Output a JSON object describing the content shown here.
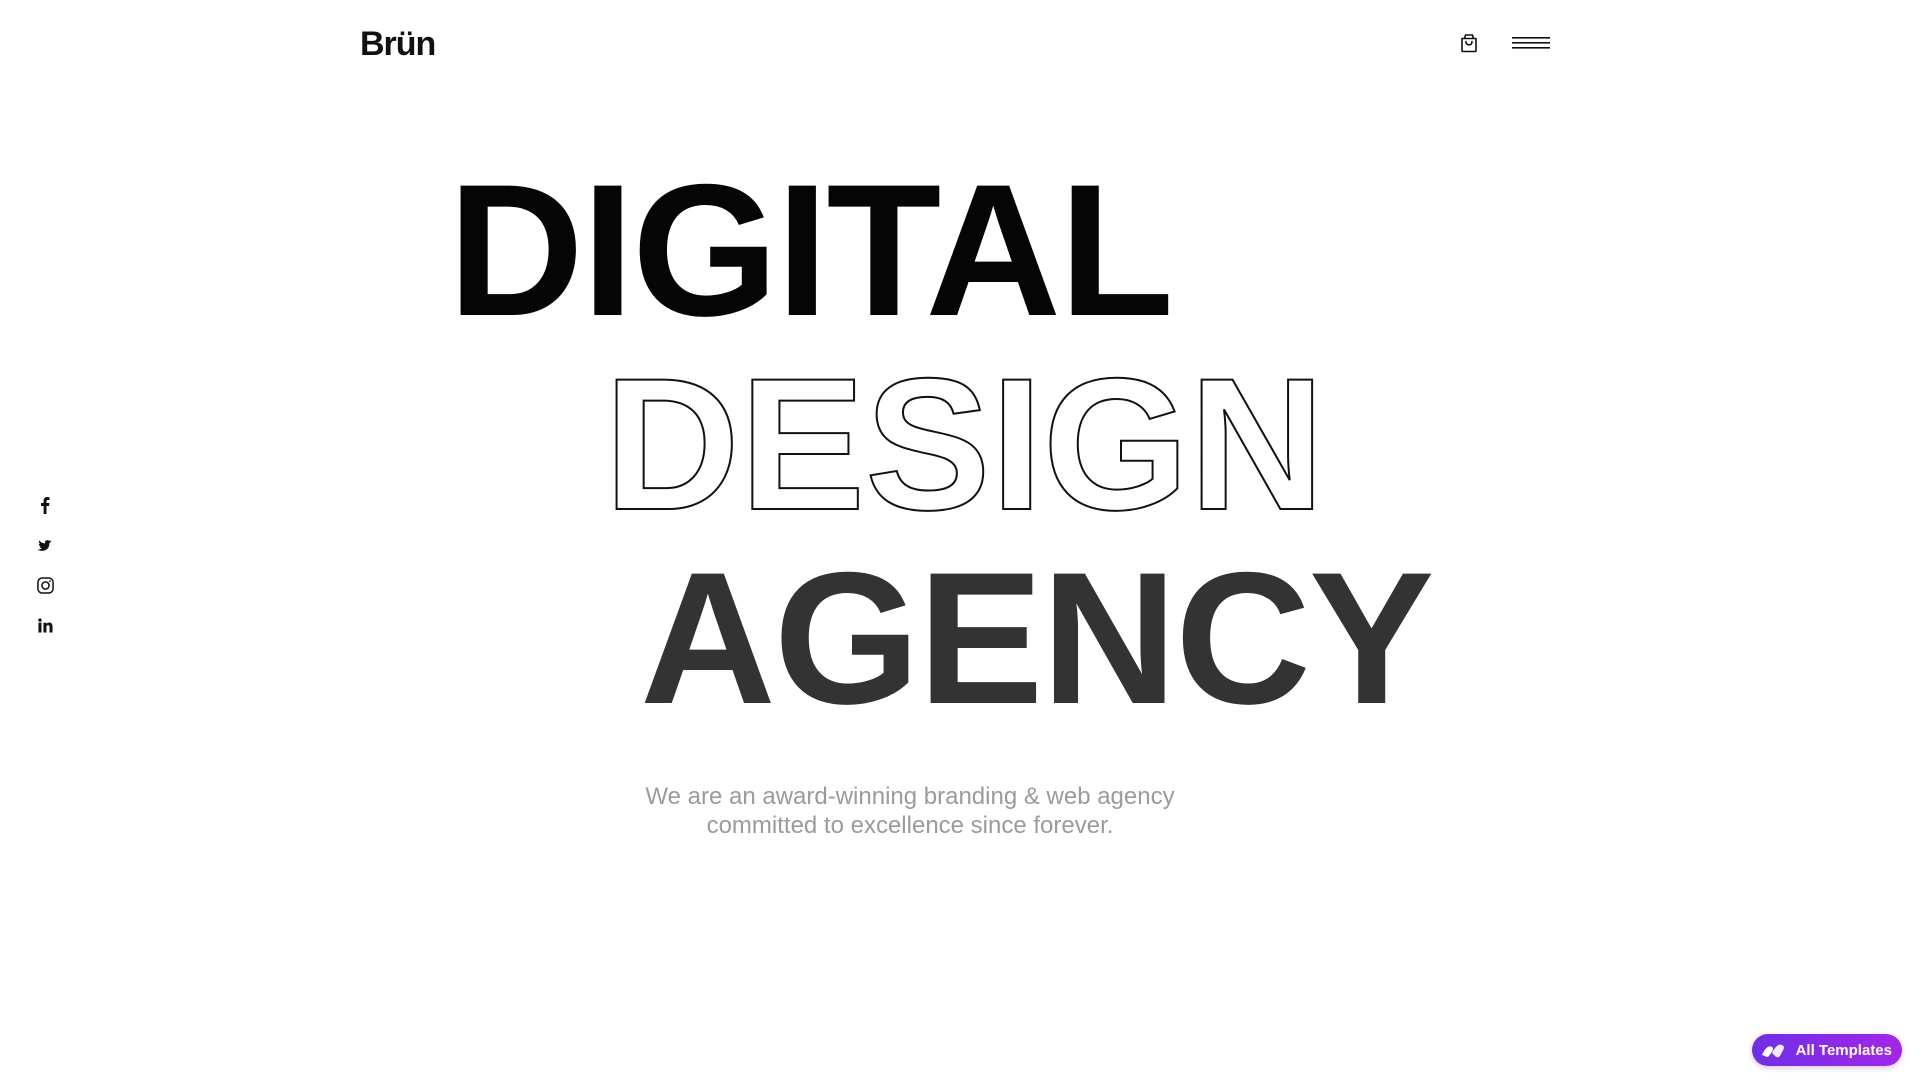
{
  "header": {
    "logo_text": "Brün"
  },
  "icons": {
    "cart": "shopping-bag-icon",
    "menu": "hamburger-menu-icon",
    "social": [
      "facebook-icon",
      "twitter-icon",
      "instagram-icon",
      "linkedin-icon"
    ],
    "badge": "templates-logo-icon"
  },
  "hero": {
    "line1": "DIGITAL",
    "line2": "DESIGN",
    "line3": "AGENCY",
    "tagline_line1": "We are an award-winning branding & web agency",
    "tagline_line2": "committed to excellence since forever."
  },
  "badge": {
    "label": "All Templates"
  },
  "colors": {
    "line1": "#050505",
    "line2_stroke": "#111111",
    "line3": "#333333",
    "tagline": "#9b9b9b",
    "badge_gradient_start": "#6f2fe6",
    "badge_gradient_end": "#a326e8"
  }
}
